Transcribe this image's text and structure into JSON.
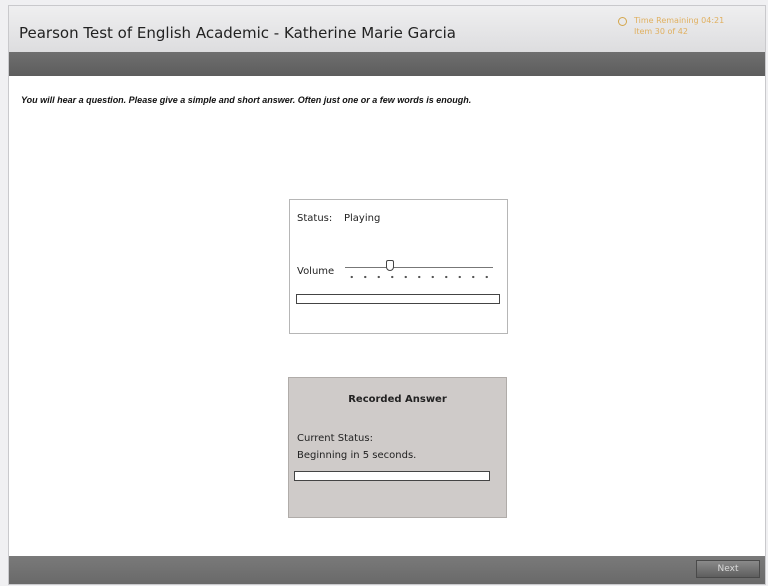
{
  "header": {
    "title": "Pearson Test of English Academic - Katherine Marie Garcia",
    "timer_icon": "clock-icon",
    "time_remaining": "Time Remaining 04:21",
    "item_counter": "Item 30 of 42",
    "accent_color": "#e0b060"
  },
  "instruction": "You will hear a question. Please give a simple and short answer. Often just one or a few words is enough.",
  "audio_player": {
    "status_label": "Status:",
    "status_value": "Playing",
    "volume_label": "Volume",
    "volume_level_fraction": 0.3,
    "progress_fraction": 0
  },
  "recorder": {
    "title": "Recorded Answer",
    "current_status_label": "Current Status:",
    "current_status_value": "Beginning in 5 seconds.",
    "progress_fraction": 0
  },
  "footer": {
    "next_label": "Next"
  }
}
